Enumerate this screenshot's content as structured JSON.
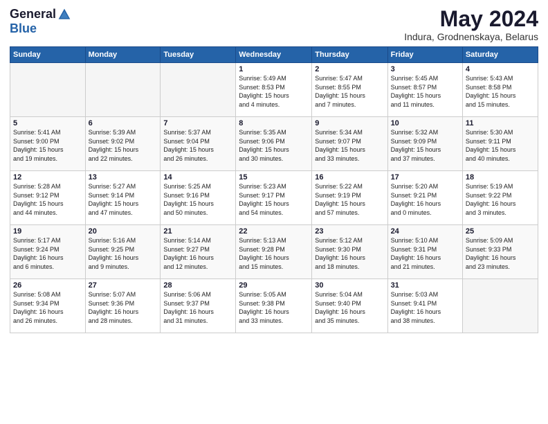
{
  "header": {
    "logo_general": "General",
    "logo_blue": "Blue",
    "month_year": "May 2024",
    "location": "Indura, Grodnenskaya, Belarus"
  },
  "days_of_week": [
    "Sunday",
    "Monday",
    "Tuesday",
    "Wednesday",
    "Thursday",
    "Friday",
    "Saturday"
  ],
  "weeks": [
    [
      {
        "day": "",
        "empty": true
      },
      {
        "day": "",
        "empty": true
      },
      {
        "day": "",
        "empty": true
      },
      {
        "day": "1",
        "info": "Sunrise: 5:49 AM\nSunset: 8:53 PM\nDaylight: 15 hours\nand 4 minutes."
      },
      {
        "day": "2",
        "info": "Sunrise: 5:47 AM\nSunset: 8:55 PM\nDaylight: 15 hours\nand 7 minutes."
      },
      {
        "day": "3",
        "info": "Sunrise: 5:45 AM\nSunset: 8:57 PM\nDaylight: 15 hours\nand 11 minutes."
      },
      {
        "day": "4",
        "info": "Sunrise: 5:43 AM\nSunset: 8:58 PM\nDaylight: 15 hours\nand 15 minutes."
      }
    ],
    [
      {
        "day": "5",
        "info": "Sunrise: 5:41 AM\nSunset: 9:00 PM\nDaylight: 15 hours\nand 19 minutes."
      },
      {
        "day": "6",
        "info": "Sunrise: 5:39 AM\nSunset: 9:02 PM\nDaylight: 15 hours\nand 22 minutes."
      },
      {
        "day": "7",
        "info": "Sunrise: 5:37 AM\nSunset: 9:04 PM\nDaylight: 15 hours\nand 26 minutes."
      },
      {
        "day": "8",
        "info": "Sunrise: 5:35 AM\nSunset: 9:06 PM\nDaylight: 15 hours\nand 30 minutes."
      },
      {
        "day": "9",
        "info": "Sunrise: 5:34 AM\nSunset: 9:07 PM\nDaylight: 15 hours\nand 33 minutes."
      },
      {
        "day": "10",
        "info": "Sunrise: 5:32 AM\nSunset: 9:09 PM\nDaylight: 15 hours\nand 37 minutes."
      },
      {
        "day": "11",
        "info": "Sunrise: 5:30 AM\nSunset: 9:11 PM\nDaylight: 15 hours\nand 40 minutes."
      }
    ],
    [
      {
        "day": "12",
        "info": "Sunrise: 5:28 AM\nSunset: 9:12 PM\nDaylight: 15 hours\nand 44 minutes."
      },
      {
        "day": "13",
        "info": "Sunrise: 5:27 AM\nSunset: 9:14 PM\nDaylight: 15 hours\nand 47 minutes."
      },
      {
        "day": "14",
        "info": "Sunrise: 5:25 AM\nSunset: 9:16 PM\nDaylight: 15 hours\nand 50 minutes."
      },
      {
        "day": "15",
        "info": "Sunrise: 5:23 AM\nSunset: 9:17 PM\nDaylight: 15 hours\nand 54 minutes."
      },
      {
        "day": "16",
        "info": "Sunrise: 5:22 AM\nSunset: 9:19 PM\nDaylight: 15 hours\nand 57 minutes."
      },
      {
        "day": "17",
        "info": "Sunrise: 5:20 AM\nSunset: 9:21 PM\nDaylight: 16 hours\nand 0 minutes."
      },
      {
        "day": "18",
        "info": "Sunrise: 5:19 AM\nSunset: 9:22 PM\nDaylight: 16 hours\nand 3 minutes."
      }
    ],
    [
      {
        "day": "19",
        "info": "Sunrise: 5:17 AM\nSunset: 9:24 PM\nDaylight: 16 hours\nand 6 minutes."
      },
      {
        "day": "20",
        "info": "Sunrise: 5:16 AM\nSunset: 9:25 PM\nDaylight: 16 hours\nand 9 minutes."
      },
      {
        "day": "21",
        "info": "Sunrise: 5:14 AM\nSunset: 9:27 PM\nDaylight: 16 hours\nand 12 minutes."
      },
      {
        "day": "22",
        "info": "Sunrise: 5:13 AM\nSunset: 9:28 PM\nDaylight: 16 hours\nand 15 minutes."
      },
      {
        "day": "23",
        "info": "Sunrise: 5:12 AM\nSunset: 9:30 PM\nDaylight: 16 hours\nand 18 minutes."
      },
      {
        "day": "24",
        "info": "Sunrise: 5:10 AM\nSunset: 9:31 PM\nDaylight: 16 hours\nand 21 minutes."
      },
      {
        "day": "25",
        "info": "Sunrise: 5:09 AM\nSunset: 9:33 PM\nDaylight: 16 hours\nand 23 minutes."
      }
    ],
    [
      {
        "day": "26",
        "info": "Sunrise: 5:08 AM\nSunset: 9:34 PM\nDaylight: 16 hours\nand 26 minutes."
      },
      {
        "day": "27",
        "info": "Sunrise: 5:07 AM\nSunset: 9:36 PM\nDaylight: 16 hours\nand 28 minutes."
      },
      {
        "day": "28",
        "info": "Sunrise: 5:06 AM\nSunset: 9:37 PM\nDaylight: 16 hours\nand 31 minutes."
      },
      {
        "day": "29",
        "info": "Sunrise: 5:05 AM\nSunset: 9:38 PM\nDaylight: 16 hours\nand 33 minutes."
      },
      {
        "day": "30",
        "info": "Sunrise: 5:04 AM\nSunset: 9:40 PM\nDaylight: 16 hours\nand 35 minutes."
      },
      {
        "day": "31",
        "info": "Sunrise: 5:03 AM\nSunset: 9:41 PM\nDaylight: 16 hours\nand 38 minutes."
      },
      {
        "day": "",
        "empty": true
      }
    ]
  ]
}
